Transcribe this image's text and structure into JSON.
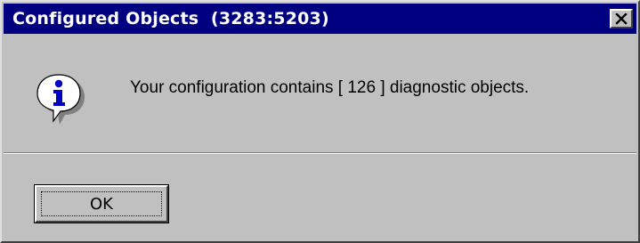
{
  "window": {
    "title": "Configured Objects  (3283:5203)",
    "title_bar_color": "#000080",
    "face_color": "#c0c0c0"
  },
  "icons": {
    "close": "close-icon",
    "info": "info-icon"
  },
  "dialog": {
    "message": "Your configuration contains [ 126 ] diagnostic objects."
  },
  "buttons": {
    "ok_label": "OK"
  }
}
